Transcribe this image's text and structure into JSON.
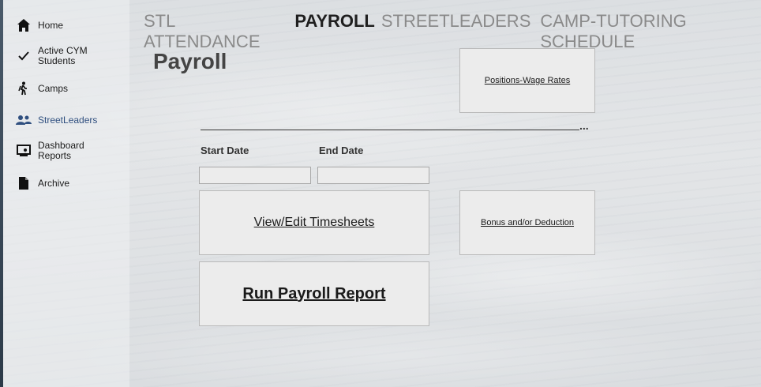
{
  "sidebar": {
    "items": [
      {
        "label": "Home",
        "icon": "home-icon"
      },
      {
        "label": "Active CYM Students",
        "icon": "checkmark-icon"
      },
      {
        "label": "Camps",
        "icon": "hiker-icon"
      },
      {
        "label": "StreetLeaders",
        "icon": "people-icon"
      },
      {
        "label": "Dashboard Reports",
        "icon": "dashboard-icon"
      },
      {
        "label": "Archive",
        "icon": "document-icon"
      }
    ]
  },
  "topnav": {
    "tabs": [
      {
        "label": "STL ATTENDANCE"
      },
      {
        "label": "PAYROLL"
      },
      {
        "label": "STREETLEADERS"
      },
      {
        "label": "CAMP-TUTORING SCHEDULE"
      }
    ]
  },
  "main": {
    "title": "Payroll",
    "positions_wage_label": "Positions-Wage Rates",
    "ellipsis": "...",
    "start_date_label": "Start Date",
    "end_date_label": "End Date",
    "start_date_value": "",
    "end_date_value": "",
    "view_timesheets_label": "View/Edit Timesheets",
    "bonus_deduction_label": "Bonus and/or Deduction",
    "run_payroll_label": "Run Payroll Report"
  },
  "colors": {
    "active_nav": "#2f4f7f",
    "active_tab": "#1f1f1f",
    "inactive_tab": "#8a8a8a"
  }
}
